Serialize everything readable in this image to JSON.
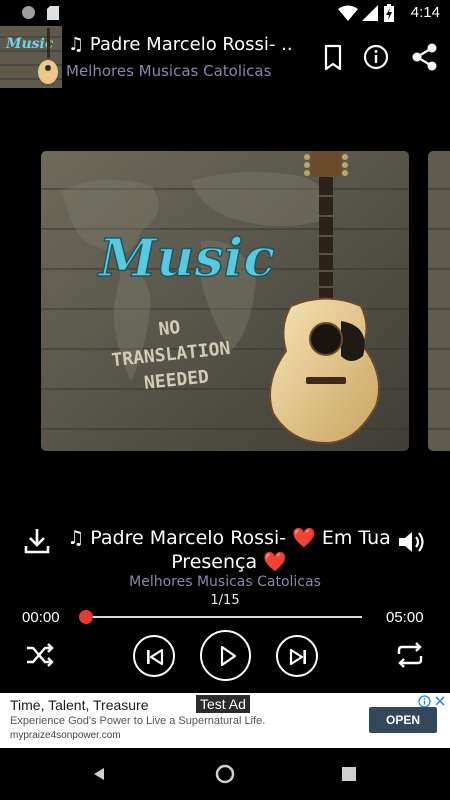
{
  "status_bar": {
    "time": "4:14"
  },
  "app_bar": {
    "title": "♫ Padre Marcelo Rossi- ..",
    "subtitle": "Melhores Musicas Catolicas",
    "icons": [
      "bookmark-icon",
      "info-icon",
      "share-icon"
    ]
  },
  "cover": {
    "headline": "Music",
    "stamp_line1": "NO",
    "stamp_line2": "TRANSLATION",
    "stamp_line3": "NEEDED"
  },
  "player": {
    "song_title": "♫ Padre Marcelo Rossi- ❤️ Em Tua Presença ❤️",
    "artist": "Melhores Musicas Catolicas",
    "track_count": "1/15",
    "elapsed": "00:00",
    "duration": "05:00",
    "progress": 0.0,
    "accent_color": "#e53935"
  },
  "ad": {
    "title": "Time, Talent, Treasure",
    "label": "Test Ad",
    "body": "Experience God's Power to Live a Supernatural Life.",
    "url": "mypraize4sonpower.com",
    "cta": "OPEN"
  }
}
